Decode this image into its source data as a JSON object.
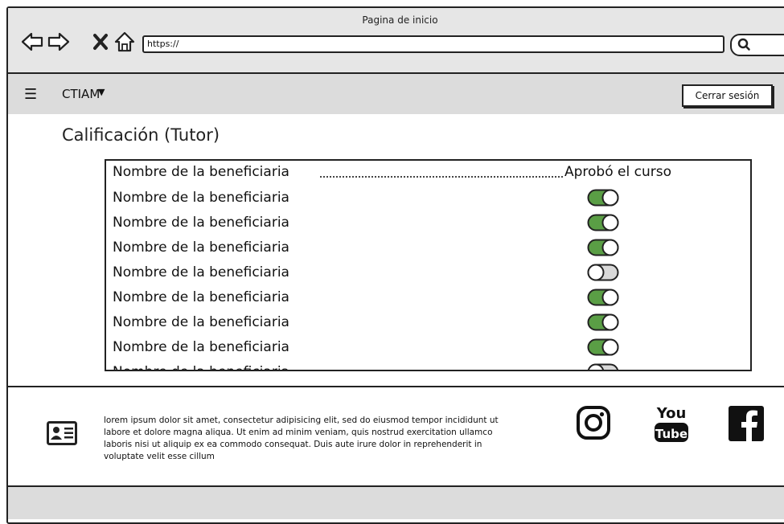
{
  "window": {
    "title": "Pagina de inicio"
  },
  "address_bar": {
    "url": "https://"
  },
  "navbar": {
    "brand": "CTIAM",
    "logout_label": "Cerrar sesión"
  },
  "page": {
    "title": "Calificación (Tutor)"
  },
  "list": {
    "header": {
      "name": "Nombre de la beneficiaria",
      "status": "Aprobó el curso"
    },
    "rows": [
      {
        "name": "Nombre de la beneficiaria",
        "approved": true
      },
      {
        "name": "Nombre de la beneficiaria",
        "approved": true
      },
      {
        "name": "Nombre de la beneficiaria",
        "approved": true
      },
      {
        "name": "Nombre de la beneficiaria",
        "approved": false
      },
      {
        "name": "Nombre de la beneficiaria",
        "approved": true
      },
      {
        "name": "Nombre de la beneficiaria",
        "approved": true
      },
      {
        "name": "Nombre de la beneficiaria",
        "approved": true
      },
      {
        "name": "Nombre de la beneficiaria",
        "approved": false
      },
      {
        "name": "Nombre de la beneficiaria",
        "approved": false
      }
    ]
  },
  "footer": {
    "text": "lorem ipsum dolor sit amet, consectetur adipisicing elit, sed do eiusmod tempor incididunt ut labore et dolore magna aliqua. Ut enim ad minim veniam, quis nostrud exercitation ullamco laboris nisi ut aliquip ex ea commodo consequat. Duis aute irure dolor in reprehenderit in voluptate velit esse cillum",
    "youtube_top": "You",
    "youtube_bottom": "Tube"
  },
  "colors": {
    "toggle_on": "#5a9e45",
    "toggle_off": "#d9d9d9",
    "bar": "#dcdcdc"
  },
  "icons": [
    "back-icon",
    "forward-icon",
    "close-icon",
    "home-icon",
    "search-icon",
    "menu-icon",
    "caret-down-icon",
    "contact-card-icon",
    "instagram-icon",
    "youtube-icon",
    "facebook-icon"
  ]
}
